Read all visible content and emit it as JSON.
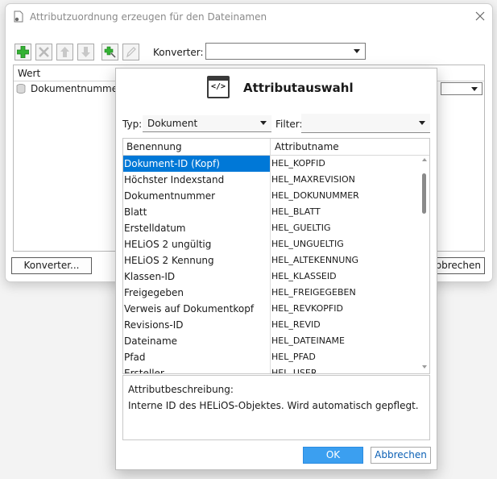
{
  "background_dialog": {
    "title": "Attributzuordnung erzeugen für den Dateinamen",
    "toolbar": {
      "converter_label": "Konverter:",
      "converter_value": ""
    },
    "table": {
      "column_header": "Wert",
      "row_label": "Dokumentnummer"
    },
    "buttons": {
      "converter": "Konverter...",
      "cancel": "bbrechen"
    }
  },
  "dialog": {
    "title": "Attributauswahl",
    "type_label": "Typ:",
    "type_value": "Dokument",
    "filter_label": "Filter:",
    "filter_value": "",
    "columns": [
      "Benennung",
      "Attributname"
    ],
    "rows": [
      {
        "name": "Dokument-ID (Kopf)",
        "attr": "HEL_KOPFID"
      },
      {
        "name": "Höchster Indexstand",
        "attr": "HEL_MAXREVISION"
      },
      {
        "name": "Dokumentnummer",
        "attr": "HEL_DOKUNUMMER"
      },
      {
        "name": "Blatt",
        "attr": "HEL_BLATT"
      },
      {
        "name": "Erstelldatum",
        "attr": "HEL_GUELTIG"
      },
      {
        "name": "HELiOS 2 ungültig",
        "attr": "HEL_UNGUELTIG"
      },
      {
        "name": "HELiOS 2  Kennung",
        "attr": "HEL_ALTEKENNUNG"
      },
      {
        "name": "Klassen-ID",
        "attr": "HEL_KLASSEID"
      },
      {
        "name": "Freigegeben",
        "attr": "HEL_FREIGEGEBEN"
      },
      {
        "name": "Verweis auf Dokumentkopf",
        "attr": "HEL_REVKOPFID"
      },
      {
        "name": "Revisions-ID",
        "attr": "HEL_REVID"
      },
      {
        "name": "Dateiname",
        "attr": "HEL_DATEINAME"
      },
      {
        "name": "Pfad",
        "attr": "HEL_PFAD"
      },
      {
        "name": "Ersteller",
        "attr": "HEL_USER"
      }
    ],
    "selected_row": 0,
    "description_label": "Attributbeschreibung:",
    "description_text": "Interne ID des HELiOS-Objektes. Wird automatisch gepflegt.",
    "ok_label": "OK",
    "cancel_label": "Abbrechen"
  },
  "colors": {
    "selection": "#0078d7",
    "ok_button": "#3b9ff0",
    "add_icon": "#2fa52f"
  }
}
